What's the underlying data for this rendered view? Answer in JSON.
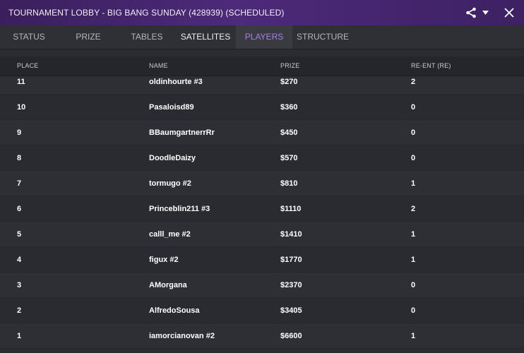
{
  "window": {
    "title": "TOURNAMENT LOBBY - BIG BANG SUNDAY (428939) (SCHEDULED)",
    "share_icon": "share-icon",
    "dropdown_icon": "chevron-down-icon",
    "close_icon": "close-icon"
  },
  "tabs": [
    {
      "label": "STATUS"
    },
    {
      "label": "PRIZE"
    },
    {
      "label": "TABLES"
    },
    {
      "label": "SATELLITES"
    },
    {
      "label": "PLAYERS"
    },
    {
      "label": "STRUCTURE"
    }
  ],
  "active_tab": "PLAYERS",
  "table": {
    "headers": {
      "place": "PLACE",
      "name": "NAME",
      "prize": "PRIZE",
      "reentries": "RE-ENT (RE)"
    },
    "rows": [
      {
        "place": "11",
        "name": "oldinhourte #3",
        "prize": "$270",
        "reentries": "2"
      },
      {
        "place": "10",
        "name": "Pasaloisd89",
        "prize": "$360",
        "reentries": "0"
      },
      {
        "place": "9",
        "name": "BBaumgartnerrRr",
        "prize": "$450",
        "reentries": "0"
      },
      {
        "place": "8",
        "name": "DoodleDaizy",
        "prize": "$570",
        "reentries": "0"
      },
      {
        "place": "7",
        "name": "tormugo #2",
        "prize": "$810",
        "reentries": "1"
      },
      {
        "place": "6",
        "name": "Princeblin211 #3",
        "prize": "$1110",
        "reentries": "2"
      },
      {
        "place": "5",
        "name": "calll_me #2",
        "prize": "$1410",
        "reentries": "1"
      },
      {
        "place": "4",
        "name": "figux #2",
        "prize": "$1770",
        "reentries": "1"
      },
      {
        "place": "3",
        "name": "AMorgana",
        "prize": "$2370",
        "reentries": "0"
      },
      {
        "place": "2",
        "name": "AlfredoSousa",
        "prize": "$3405",
        "reentries": "0"
      },
      {
        "place": "1",
        "name": "iamorcianovan #2",
        "prize": "$6600",
        "reentries": "1"
      }
    ]
  },
  "colors": {
    "accent": "#a97ee8",
    "titlebar": "#4d2a7a",
    "background": "#2b2c31"
  }
}
